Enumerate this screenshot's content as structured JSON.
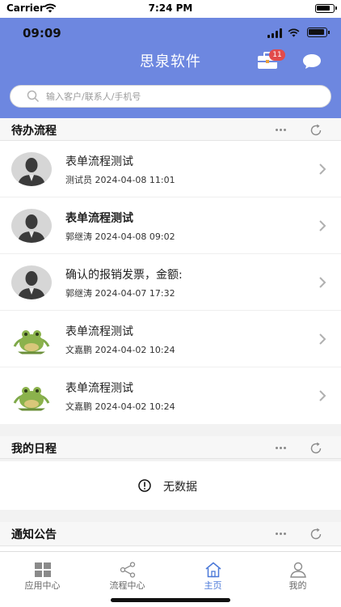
{
  "device_status": {
    "carrier": "Carrier",
    "time": "7:24 PM"
  },
  "inner_status": {
    "time": "09:09"
  },
  "header": {
    "title": "思泉软件",
    "toolbox_badge": "11"
  },
  "search": {
    "placeholder": "输入客户/联系人/手机号",
    "value": ""
  },
  "sections": {
    "todo": {
      "title": "待办流程"
    },
    "schedule": {
      "title": "我的日程",
      "empty_text": "无数据"
    },
    "notice": {
      "title": "通知公告"
    }
  },
  "todo_items": [
    {
      "title": "表单流程测试",
      "meta": "测试员 2024-04-08 11:01",
      "avatar": "person-avatar",
      "bold": false
    },
    {
      "title": "表单流程测试",
      "meta": "郭继涛 2024-04-08 09:02",
      "avatar": "person-avatar",
      "bold": true
    },
    {
      "title": "确认的报销发票，金额:",
      "meta": "郭继涛 2024-04-07 17:32",
      "avatar": "person-avatar",
      "bold": false
    },
    {
      "title": "表单流程测试",
      "meta": "文嘉鹏 2024-04-02 10:24",
      "avatar": "frog-avatar",
      "bold": false
    },
    {
      "title": "表单流程测试",
      "meta": "文嘉鹏 2024-04-02 10:24",
      "avatar": "frog-avatar",
      "bold": false
    }
  ],
  "tabbar": {
    "tabs": [
      {
        "label": "应用中心",
        "icon": "grid-icon",
        "active": false
      },
      {
        "label": "流程中心",
        "icon": "share-icon",
        "active": false
      },
      {
        "label": "主页",
        "icon": "home-icon",
        "active": true
      },
      {
        "label": "我的",
        "icon": "user-icon",
        "active": false
      }
    ]
  },
  "colors": {
    "header": "#6d87e0",
    "badge": "#e24b4b",
    "active_tab": "#4a78d8"
  }
}
